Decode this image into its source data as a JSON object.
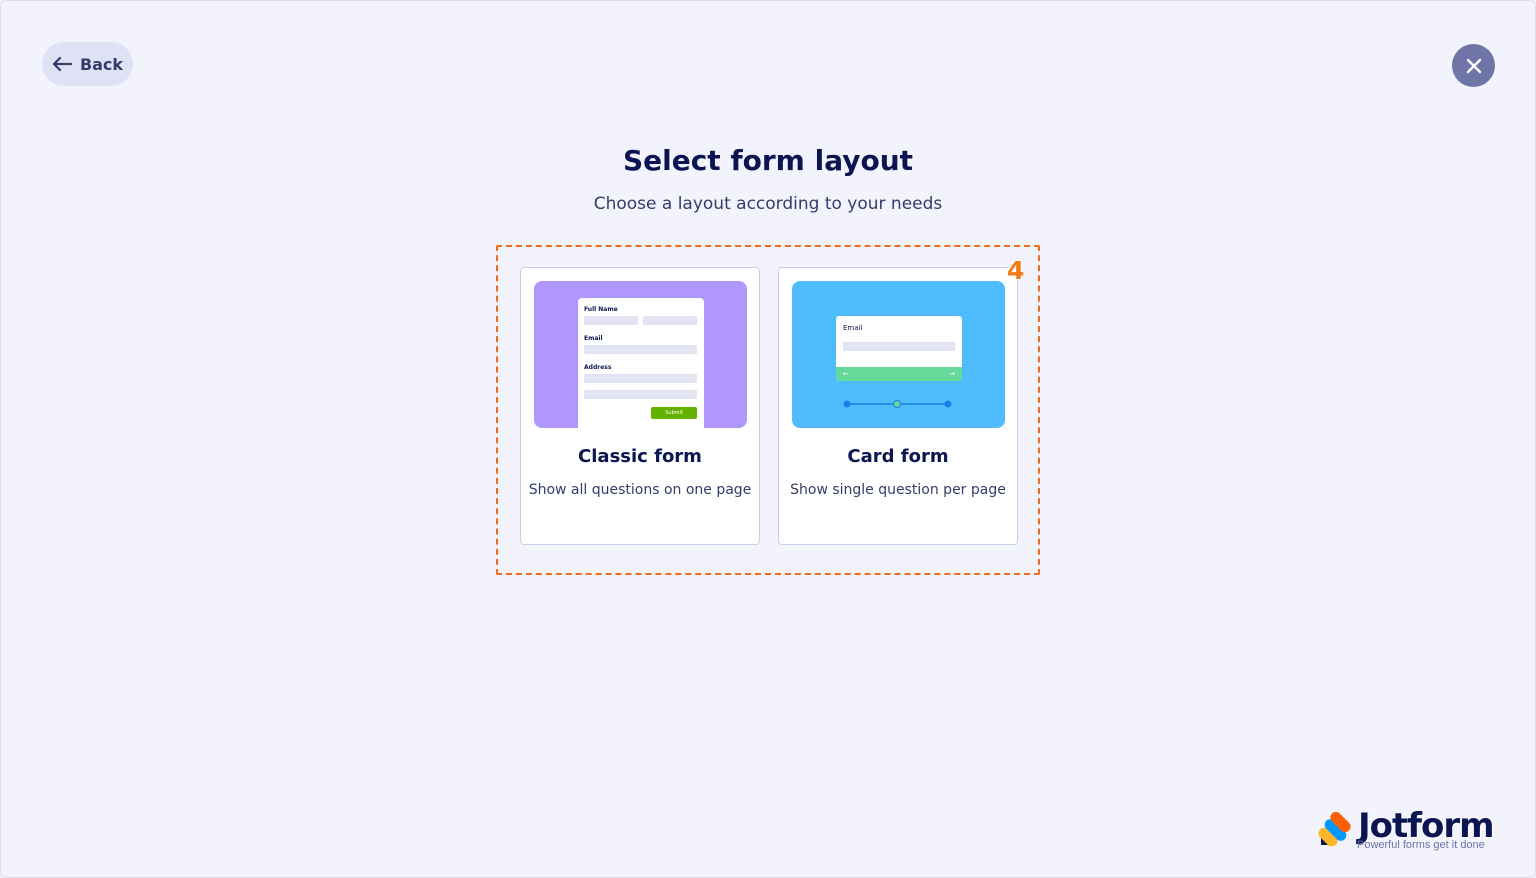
{
  "header": {
    "back_label": "Back",
    "title": "Select form layout",
    "subtitle": "Choose a layout according to your needs"
  },
  "annotation": {
    "marker": "4"
  },
  "layouts": [
    {
      "title": "Classic form",
      "description": "Show all questions on one page",
      "preview": {
        "labels": [
          "Full Name",
          "Email",
          "Address"
        ],
        "submit_label": "Submit"
      }
    },
    {
      "title": "Card form",
      "description": "Show single question per page",
      "preview": {
        "label": "Email",
        "prev_glyph": "←",
        "next_glyph": "→"
      }
    }
  ],
  "brand": {
    "name": "Jotform",
    "tagline": "Powerful forms get it done"
  },
  "colors": {
    "background": "#f3f3fe",
    "navy": "#0a1551",
    "classic_preview": "#b097fc",
    "card_preview": "#4fbdfd",
    "submit_green": "#64b200",
    "highlight_orange": "#f26a20"
  },
  "icons": {
    "back": "arrow-left-icon",
    "close": "close-icon",
    "logo": "jotform-logo-icon"
  }
}
